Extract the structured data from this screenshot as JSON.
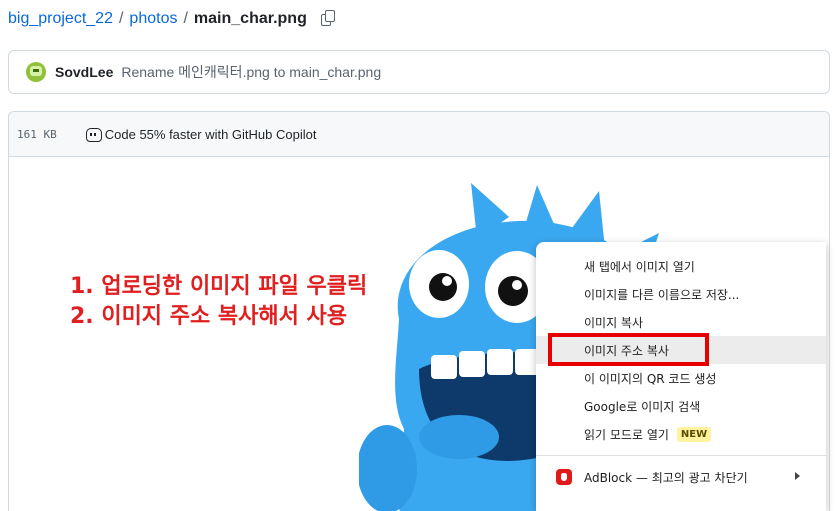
{
  "breadcrumb": {
    "repo": "big_project_22",
    "sep": "/",
    "folder": "photos",
    "file": "main_char.png",
    "copy_icon": "copy-icon"
  },
  "commit": {
    "avatar_icon": "pixel-avatar",
    "author": "SovdLee",
    "message": "Rename 메인캐릭터.png to main_char.png"
  },
  "file_header": {
    "size": "161 KB",
    "copilot_icon": "copilot-icon",
    "copilot_label": "Code 55% faster with GitHub Copilot"
  },
  "instructions": {
    "line1": "1.  업로딩한 이미지 파일 우클릭",
    "line2": "2.  이미지 주소 복사해서 사용"
  },
  "context_menu": {
    "items": [
      {
        "label": "새 탭에서 이미지 열기"
      },
      {
        "label": "이미지를 다른 이름으로 저장..."
      },
      {
        "label": "이미지 복사"
      },
      {
        "label": "이미지 주소 복사"
      },
      {
        "label": "이 이미지의 QR 코드 생성"
      },
      {
        "label": "Google로 이미지 검색"
      },
      {
        "label": "읽기 모드로 열기",
        "badge": "NEW"
      }
    ],
    "adblock": {
      "label": "AdBlock — 최고의 광고 차단기",
      "icon": "adblock-icon"
    }
  },
  "colors": {
    "link": "#0969da",
    "highlight_box": "#e60000",
    "annotation_text": "#e02020",
    "mascot_blue": "#3aa8f0"
  }
}
